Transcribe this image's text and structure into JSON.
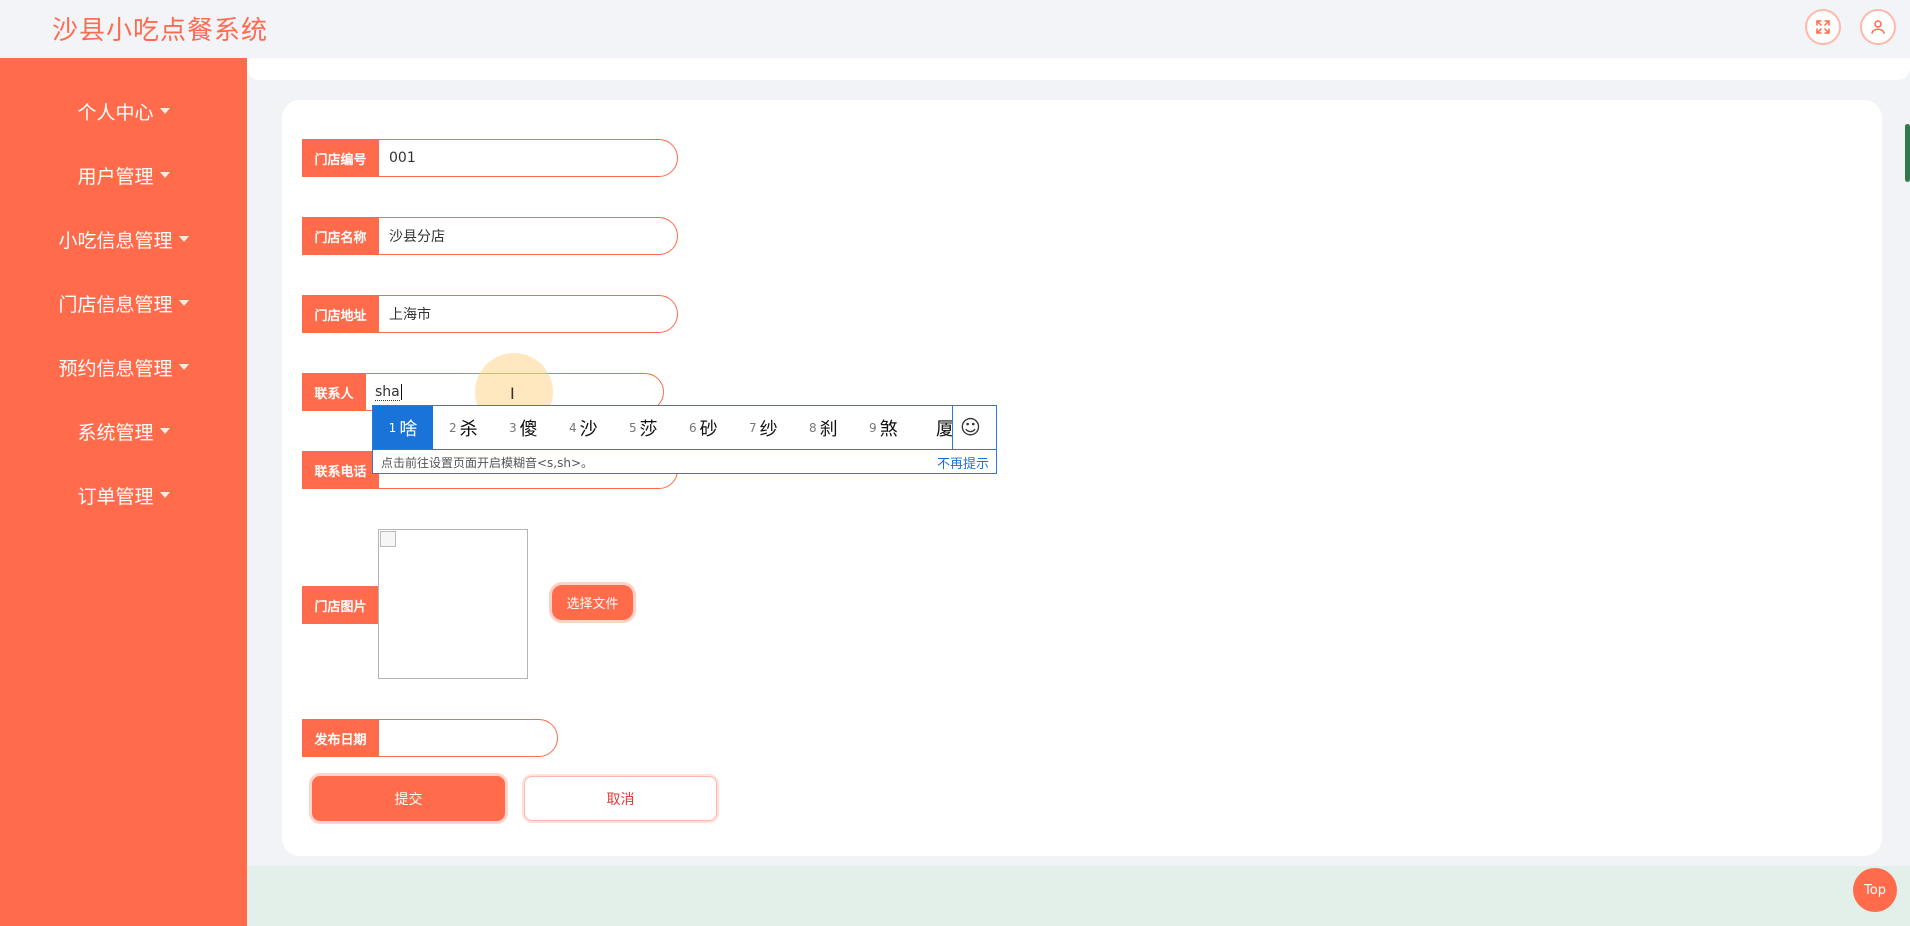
{
  "header": {
    "title": "沙县小吃点餐系统",
    "fullscreen_icon": "expand-icon",
    "user_icon": "user-icon"
  },
  "sidebar": {
    "items": [
      {
        "label": "个人中心"
      },
      {
        "label": "用户管理"
      },
      {
        "label": "小吃信息管理"
      },
      {
        "label": "门店信息管理"
      },
      {
        "label": "预约信息管理"
      },
      {
        "label": "系统管理"
      },
      {
        "label": "订单管理"
      }
    ]
  },
  "form": {
    "store_no_label": "门店编号",
    "store_no_value": "001",
    "store_name_label": "门店名称",
    "store_name_value": "沙县分店",
    "store_addr_label": "门店地址",
    "store_addr_value": "上海市",
    "contact_label": "联系人",
    "contact_value": "sha",
    "phone_label": "联系电话",
    "image_label": "门店图片",
    "choose_file": "选择文件",
    "publish_date_label": "发布日期",
    "publish_date_value": "",
    "submit": "提交",
    "cancel": "取消"
  },
  "ime": {
    "candidates": [
      {
        "num": "1",
        "text": "啥"
      },
      {
        "num": "2",
        "text": "杀"
      },
      {
        "num": "3",
        "text": "傻"
      },
      {
        "num": "4",
        "text": "沙"
      },
      {
        "num": "5",
        "text": "莎"
      },
      {
        "num": "6",
        "text": "砂"
      },
      {
        "num": "7",
        "text": "纱"
      },
      {
        "num": "8",
        "text": "刹"
      },
      {
        "num": "9",
        "text": "煞"
      },
      {
        "num": "",
        "text": "厦"
      }
    ],
    "emoji": "☺",
    "hint": "点击前往设置页面开启模糊音<s,sh>。",
    "dont_show": "不再提示"
  },
  "top_button": "Top",
  "colors": {
    "accent": "#ff6b4b",
    "ime_blue": "#1a73d9"
  }
}
